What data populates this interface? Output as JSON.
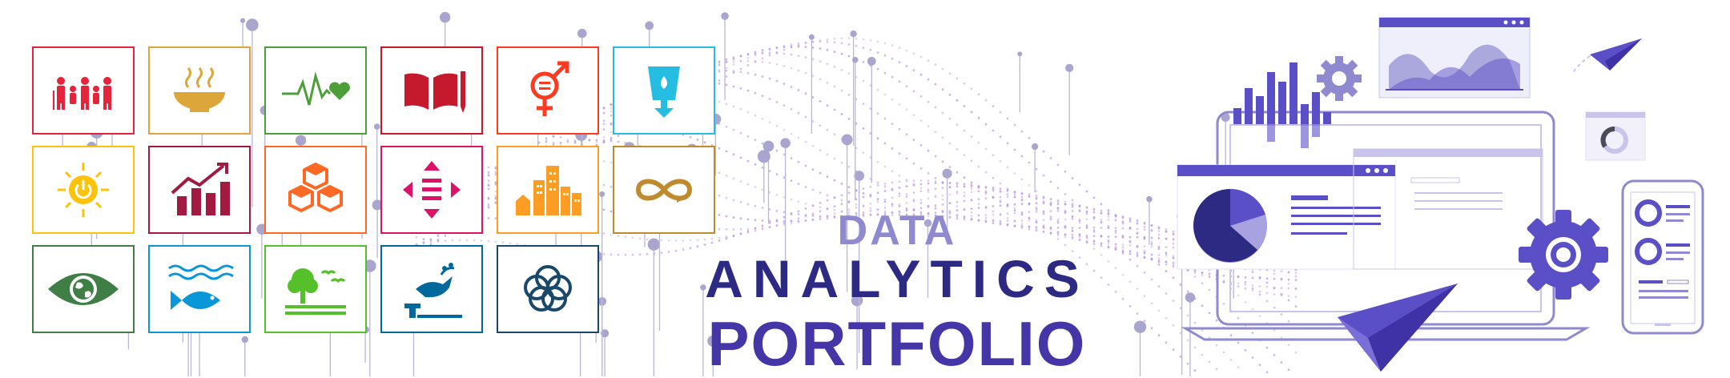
{
  "banner": {
    "title_line1": "DATA",
    "title_line2": "ANALYTICS",
    "title_line3": "PORTFOLIO"
  },
  "colors": {
    "title_primary": "#2c2a83",
    "title_accent": "#4536a8",
    "title_light": "#8f8ad0",
    "illustration_purple": "#5b4fc7",
    "wave_purple": "#b18ad6"
  },
  "sdg_icons": [
    {
      "name": "family-icon",
      "color": "#e5243b"
    },
    {
      "name": "food-bowl-icon",
      "color": "#dda63a"
    },
    {
      "name": "heartbeat-icon",
      "color": "#4c9f38"
    },
    {
      "name": "book-pencil-icon",
      "color": "#c5192d"
    },
    {
      "name": "gender-equality-icon",
      "color": "#ff3a21"
    },
    {
      "name": "water-tap-icon",
      "color": "#26bde2"
    },
    {
      "name": "sun-power-icon",
      "color": "#fcc30b"
    },
    {
      "name": "growth-chart-icon",
      "color": "#a21942"
    },
    {
      "name": "cubes-icon",
      "color": "#fd6925"
    },
    {
      "name": "equality-arrows-icon",
      "color": "#dd1367"
    },
    {
      "name": "city-buildings-icon",
      "color": "#fd9d24"
    },
    {
      "name": "infinity-icon",
      "color": "#bf8b2e"
    },
    {
      "name": "eye-globe-icon",
      "color": "#3f7e44"
    },
    {
      "name": "fish-waves-icon",
      "color": "#0a97d9"
    },
    {
      "name": "tree-birds-icon",
      "color": "#56c02b"
    },
    {
      "name": "dove-gavel-icon",
      "color": "#00689d"
    },
    {
      "name": "rings-icon",
      "color": "#19486a"
    }
  ]
}
